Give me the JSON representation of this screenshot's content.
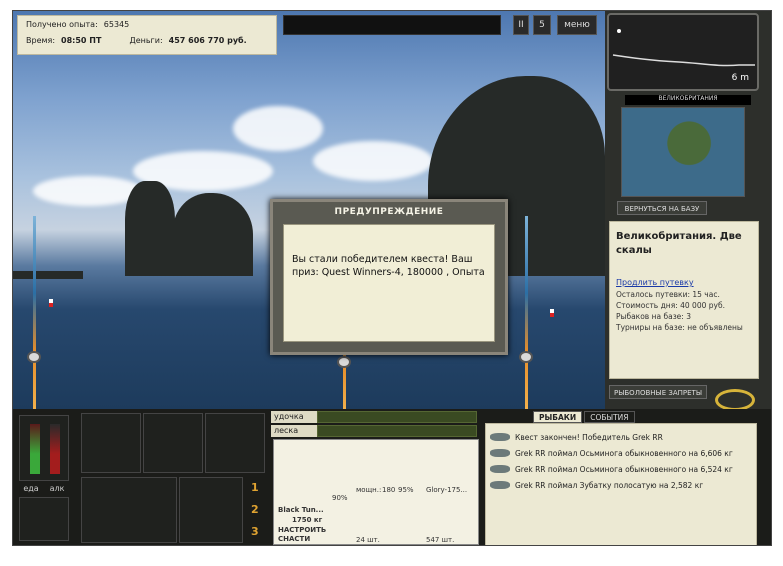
{
  "info": {
    "exp_label": "Получено опыта:",
    "exp_value": "65345",
    "time_label": "Время:",
    "time_value": "08:50 ПТ",
    "money_label": "Деньги:",
    "money_value": "457 606 770 руб."
  },
  "top_controls": {
    "pause": "II",
    "speed": "5",
    "menu": "меню"
  },
  "dialog": {
    "title": "ПРЕДУПРЕЖДЕНИЕ",
    "message": "Вы стали победителем квеста! Ваш приз: Quest Winners-4, 180000 , Опыта"
  },
  "right_panel": {
    "depth": "6 m",
    "map_title": "ВЕЛИКОБРИТАНИЯ",
    "return_button": "ВЕРНУТЬСЯ НА БАЗУ",
    "location_title": "Великобритания. Две скалы",
    "extend_link": "Продлить путевку",
    "lines": [
      "Осталось путевки: 15 час.",
      "Стоимость дня: 40 000 руб.",
      "Рыбаков на базе: 3",
      "Турниры на базе: не объявлены"
    ],
    "bans_button": "РЫБОЛОВНЫЕ ЗАПРЕТЫ"
  },
  "bottom": {
    "food": "еда",
    "alcohol": "алк",
    "slots": [
      "1",
      "2",
      "3"
    ],
    "rod_label": "удочка",
    "line_label": "леска",
    "tackle": {
      "fish_name": "Black Tun...",
      "fish_weight": "1750 кг",
      "percent": "90%",
      "setup": "НАСТРОИТЬ СНАСТИ",
      "reel_power_label": "мощн.:",
      "reel_power_value": "180",
      "reel_percent": "95%",
      "lure": "Glory-175...",
      "qty1": "24 шт.",
      "qty2": "547 шт."
    },
    "tabs": [
      "РЫБАКИ",
      "СОБЫТИЯ"
    ],
    "events": [
      "Квест закончен! Победитель Grek RR",
      "Grek RR поймал Осьминога обыкновенного на 6,606 кг",
      "Grek RR поймал Осьминога обыкновенного на 6,524 кг",
      "Grek RR поймал Зубатку полосатую на 2,582 кг"
    ]
  }
}
